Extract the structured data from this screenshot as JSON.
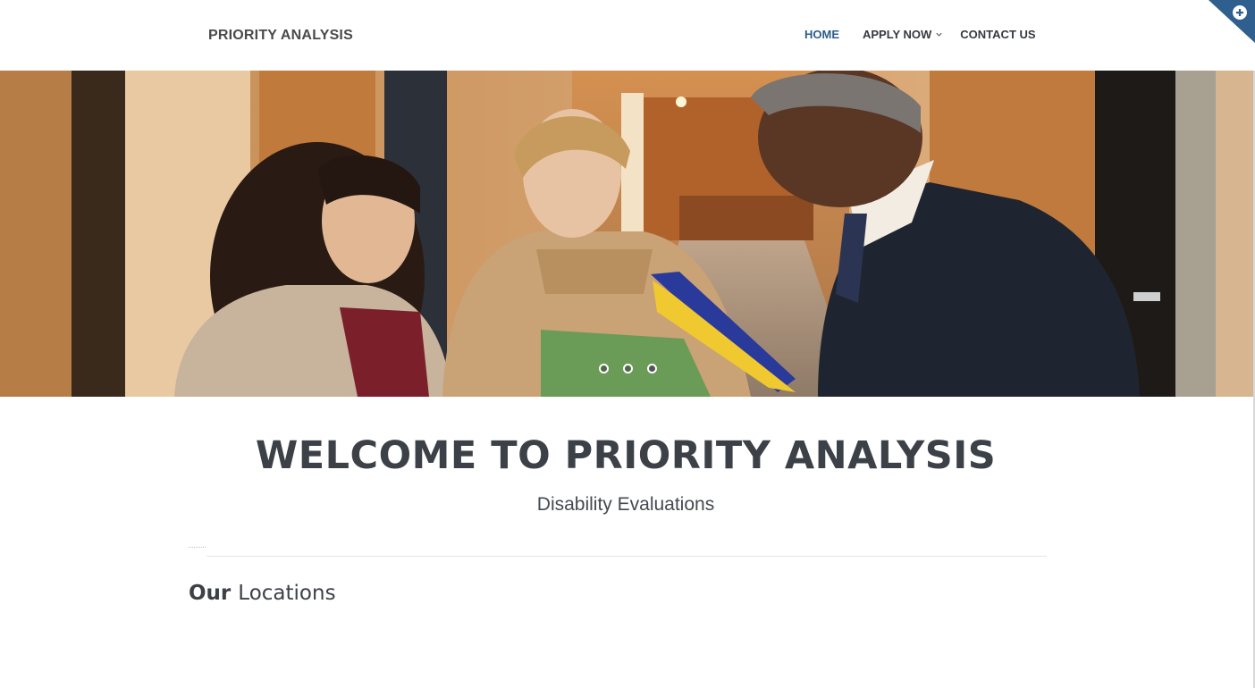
{
  "header": {
    "logo_text": "PRIORITY ANALYSIS",
    "nav": {
      "home": "HOME",
      "apply": "APPLY NOW",
      "contact": "CONTACT US"
    }
  },
  "hero": {
    "slide_count": 3,
    "active_slide": 3
  },
  "main": {
    "welcome_title": "WELCOME TO PRIORITY ANALYSIS",
    "subtitle": "Disability Evaluations",
    "section_title_strong": "Our",
    "section_title_rest": "Locations"
  },
  "icons": {
    "corner": "plus-circle-icon",
    "apply_dropdown": "chevron-down-icon"
  },
  "colors": {
    "nav_active": "#2c5d8a",
    "heading": "#3c4148",
    "corner_badge": "#2e5f8e"
  }
}
